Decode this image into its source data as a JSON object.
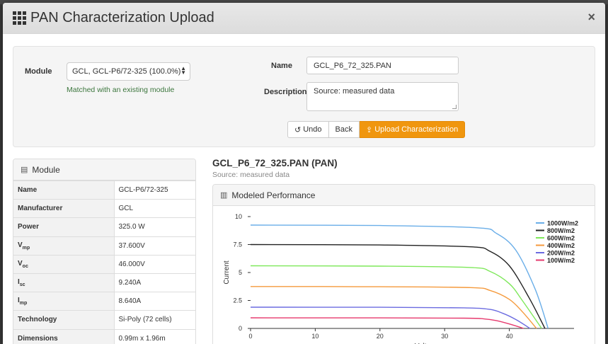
{
  "modal": {
    "title": "PAN Characterization Upload",
    "close_glyph": "×"
  },
  "form": {
    "module_label": "Module",
    "module_selected": "GCL, GCL-P6/72-325 (100.0%)",
    "match_message": "Matched with an existing module",
    "name_label": "Name",
    "name_value": "GCL_P6_72_325.PAN",
    "description_label": "Description",
    "description_value": "Source: measured data",
    "undo_label": "Undo",
    "back_label": "Back",
    "upload_label": "Upload Characterization",
    "upload_color": "#f0960e"
  },
  "module_panel": {
    "heading": "Module",
    "rows": [
      {
        "key": "Name",
        "sub": "",
        "value": "GCL-P6/72-325"
      },
      {
        "key": "Manufacturer",
        "sub": "",
        "value": "GCL"
      },
      {
        "key": "Power",
        "sub": "",
        "value": "325.0 W"
      },
      {
        "key": "V",
        "sub": "mp",
        "value": "37.600V"
      },
      {
        "key": "V",
        "sub": "oc",
        "value": "46.000V"
      },
      {
        "key": "I",
        "sub": "sc",
        "value": "9.240A"
      },
      {
        "key": "I",
        "sub": "mp",
        "value": "8.640A"
      },
      {
        "key": "Technology",
        "sub": "",
        "value": "Si-Poly (72 cells)"
      },
      {
        "key": "Dimensions",
        "sub": "",
        "value": "0.99m x 1.96m"
      }
    ]
  },
  "file": {
    "title": "GCL_P6_72_325.PAN (PAN)",
    "source": "Source: measured data"
  },
  "performance_panel": {
    "heading": "Modeled Performance"
  },
  "chart_data": {
    "type": "line",
    "xlabel": "Voltage",
    "ylabel": "Current",
    "xlim": [
      0,
      50
    ],
    "ylim": [
      0,
      10
    ],
    "xticks": [
      0,
      10,
      20,
      30,
      40
    ],
    "yticks": [
      0,
      2.5,
      5,
      7.5,
      10
    ],
    "ytick_labels": [
      "0",
      "2.5",
      "5",
      "7.5",
      "10"
    ],
    "legend_position": "top-right",
    "series": [
      {
        "name": "1000W/m2",
        "color": "#6aaee8",
        "x": [
          0,
          20,
          35,
          38,
          41,
          44,
          46.0
        ],
        "y": [
          9.24,
          9.2,
          9.0,
          8.5,
          7.0,
          3.5,
          0
        ]
      },
      {
        "name": "800W/m2",
        "color": "#222222",
        "x": [
          0,
          20,
          34,
          37,
          40,
          43,
          45.5
        ],
        "y": [
          7.5,
          7.46,
          7.3,
          6.9,
          5.6,
          2.8,
          0
        ]
      },
      {
        "name": "600W/m2",
        "color": "#7ee85a",
        "x": [
          0,
          20,
          34,
          37,
          40,
          42,
          45.0
        ],
        "y": [
          5.6,
          5.57,
          5.45,
          5.1,
          4.0,
          2.5,
          0
        ]
      },
      {
        "name": "400W/m2",
        "color": "#f59a3c",
        "x": [
          0,
          20,
          34,
          37,
          40,
          42,
          44.2
        ],
        "y": [
          3.75,
          3.73,
          3.65,
          3.4,
          2.6,
          1.5,
          0
        ]
      },
      {
        "name": "200W/m2",
        "color": "#6b6be0",
        "x": [
          0,
          20,
          33,
          37,
          39,
          41,
          43.2
        ],
        "y": [
          1.9,
          1.89,
          1.84,
          1.7,
          1.35,
          0.8,
          0
        ]
      },
      {
        "name": "100W/m2",
        "color": "#e63a6e",
        "x": [
          0,
          20,
          33,
          36,
          38,
          40,
          42.2
        ],
        "y": [
          0.95,
          0.94,
          0.92,
          0.86,
          0.7,
          0.4,
          0
        ]
      }
    ]
  }
}
